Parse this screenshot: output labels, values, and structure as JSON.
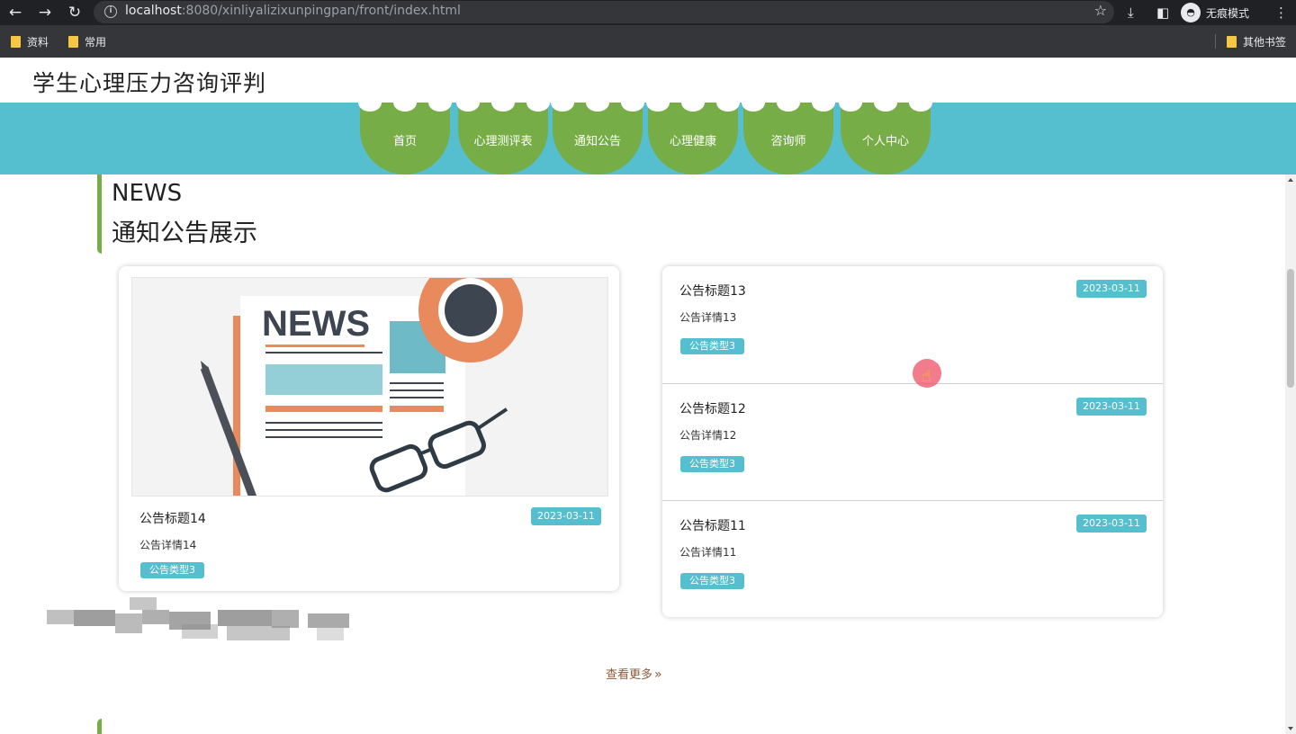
{
  "browser": {
    "url_host": "localhost",
    "url_rest": ":8080/xinliyalizixunpingpan/front/index.html",
    "incognito_label": "无痕模式",
    "bookmarks": [
      "资料",
      "常用"
    ],
    "other_bookmarks": "其他书签"
  },
  "site": {
    "title": "学生心理压力咨询评判"
  },
  "nav": {
    "items": [
      "首页",
      "心理测评表",
      "通知公告",
      "心理健康",
      "咨询师",
      "个人中心"
    ]
  },
  "section": {
    "en_title": "NEWS",
    "cn_title": "通知公告展示"
  },
  "featured_notice": {
    "title": "公告标题14",
    "date": "2023-03-11",
    "detail": "公告详情14",
    "type": "公告类型3",
    "image_text": "NEWS"
  },
  "notices": [
    {
      "title": "公告标题13",
      "date": "2023-03-11",
      "detail": "公告详情13",
      "type": "公告类型3"
    },
    {
      "title": "公告标题12",
      "date": "2023-03-11",
      "detail": "公告详情12",
      "type": "公告类型3"
    },
    {
      "title": "公告标题11",
      "date": "2023-03-11",
      "detail": "公告详情11",
      "type": "公告类型3"
    }
  ],
  "more_link": "查看更多",
  "colors": {
    "nav_band": "#56bfcf",
    "nav_tab": "#76ad47",
    "badge": "#56bfcf",
    "accent_bar": "#76ad47"
  },
  "icons": [
    "back-arrow-icon",
    "forward-arrow-icon",
    "reload-icon",
    "info-icon",
    "star-icon",
    "download-icon",
    "sidebar-icon",
    "incognito-icon",
    "menu-dots-icon",
    "folder-icon",
    "double-chevron-right-icon",
    "hand-pointer-icon"
  ]
}
